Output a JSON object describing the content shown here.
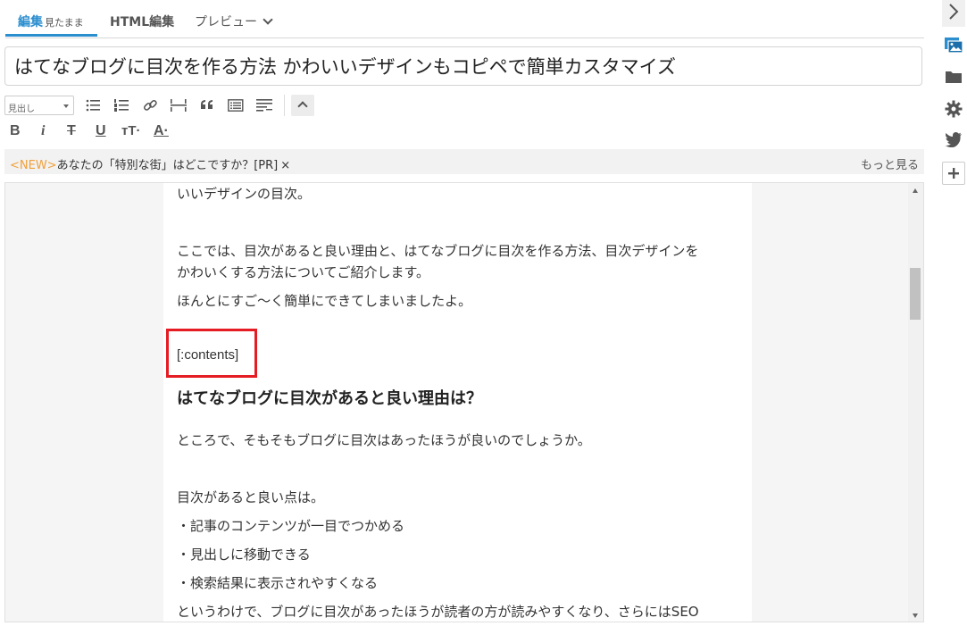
{
  "tabs": {
    "edit": "編集",
    "edit_sub": "見たまま",
    "html": "HTML編集",
    "preview": "プレビュー"
  },
  "title": "はてなブログに目次を作る方法 かわいいデザインもコピペで簡単カスタマイズ",
  "toolbar": {
    "heading_select": "見出し",
    "icons": [
      "unordered-list-icon",
      "ordered-list-icon",
      "link-icon",
      "more-separator-icon",
      "blockquote-icon",
      "table-of-contents-icon",
      "footnote-icon",
      "collapse-toolbar-icon"
    ],
    "bold": "B",
    "italic": "i",
    "strike": "T",
    "underline": "U",
    "font_size": "тT·",
    "font_color": "A·"
  },
  "adbar": {
    "new": "<NEW>",
    "text": "あなたの「特別な街」はどこですか？[PR]",
    "close": "×",
    "more": "もっと見る"
  },
  "content": {
    "line1": "いいデザインの目次。",
    "line2": "ここでは、目次があると良い理由と、はてなブログに目次を作る方法、目次デザインを",
    "line3": "かわいくする方法についてご紹介します。",
    "line4": "ほんとにすご～く簡単にできてしまいましたよ。",
    "contents_tag": "[:contents]",
    "heading": "はてなブログに目次があると良い理由は？",
    "line5": "ところで、そもそもブログに目次はあったほうが良いのでしょうか。",
    "line6": "目次があると良い点は。",
    "bullet1": "・記事のコンテンツが一目でつかめる",
    "bullet2": "・見出しに移動できる",
    "bullet3": "・検索結果に表示されやすくなる",
    "line7": "というわけで、ブログに目次があったほうが読者の方が読みやすくなり、さらにはSEO"
  },
  "highlight_color": "#e51c23",
  "accent_color": "#2b8ecf",
  "sidebar_icons": [
    "chevron-right-icon",
    "image-gallery-icon",
    "folder-icon",
    "gear-icon",
    "twitter-icon",
    "plus-icon"
  ]
}
